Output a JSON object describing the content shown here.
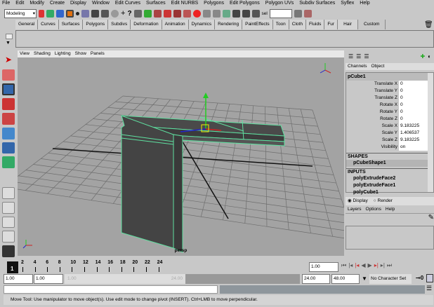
{
  "menu": [
    "File",
    "Edit",
    "Modify",
    "Create",
    "Display",
    "Window",
    "Edit Curves",
    "Surfaces",
    "Edit NURBS",
    "Polygons",
    "Edit Polygons",
    "Polygon UVs",
    "Subdiv Surfaces",
    "Syflex",
    "Help"
  ],
  "mode_select": "Modeling",
  "sel_field": "sel",
  "shelf_tabs": [
    "General",
    "Curves",
    "Surfaces",
    "Polygons",
    "Subdivs",
    "Deformation",
    "Animation",
    "Dynamics",
    "Rendering",
    "PaintEffects",
    "Toon",
    "Cloth",
    "Fluids",
    "Fur",
    "Hair",
    "Custom"
  ],
  "viewport": {
    "menu": [
      "View",
      "Shading",
      "Lighting",
      "Show",
      "Panels"
    ],
    "camera_label": "persp"
  },
  "channel_box": {
    "tabs": [
      "Channels",
      "Object"
    ],
    "object": "pCube1",
    "attributes": [
      {
        "name": "Translate X",
        "value": "0"
      },
      {
        "name": "Translate Y",
        "value": "0"
      },
      {
        "name": "Translate Z",
        "value": "0"
      },
      {
        "name": "Rotate X",
        "value": "0"
      },
      {
        "name": "Rotate Y",
        "value": "0"
      },
      {
        "name": "Rotate Z",
        "value": "0"
      },
      {
        "name": "Scale X",
        "value": "9.183225"
      },
      {
        "name": "Scale Y",
        "value": "1.406537"
      },
      {
        "name": "Scale Z",
        "value": "9.183225"
      },
      {
        "name": "Visibility",
        "value": "on"
      }
    ],
    "shapes_header": "SHAPES",
    "shape": "pCubeShape1",
    "inputs_header": "INPUTS",
    "inputs": [
      "polyExtrudeFace2",
      "polyExtrudeFace1",
      "polyCube1"
    ]
  },
  "layer_editor": {
    "display": "Display",
    "render": "Render",
    "menu": [
      "Layers",
      "Options",
      "Help"
    ]
  },
  "timeline": {
    "current_frame": "1",
    "ticks": [
      "2",
      "4",
      "6",
      "8",
      "10",
      "12",
      "14",
      "16",
      "18",
      "20",
      "22",
      "24"
    ],
    "current_time": "1.00"
  },
  "range": {
    "start": "1.00",
    "playback_start": "1.00",
    "playback_end": "24.00",
    "end": "48.00",
    "range_label_start": "1.00",
    "range_label_end": "24.00",
    "character_set": "No Character Set"
  },
  "help_line": "Move Tool: Use manipulator to move object(s). Use edit mode to change pivot (INSERT). Ctrl+LMB to move perpendicular."
}
